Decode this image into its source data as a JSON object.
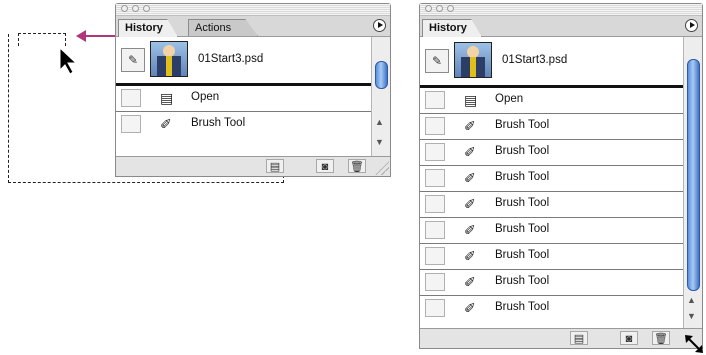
{
  "small_panel": {
    "tabs": [
      {
        "label": "History"
      },
      {
        "label": "Actions"
      }
    ],
    "snapshot": {
      "label": "01Start3.psd"
    },
    "rows": [
      {
        "label": "Open",
        "icon": "open-document-icon"
      },
      {
        "label": "Brush Tool",
        "icon": "brush-icon"
      }
    ]
  },
  "large_panel": {
    "tabs": [
      {
        "label": "History"
      }
    ],
    "snapshot": {
      "label": "01Start3.psd"
    },
    "rows": [
      {
        "label": "Open",
        "icon": "open-document-icon"
      },
      {
        "label": "Brush Tool",
        "icon": "brush-icon"
      },
      {
        "label": "Brush Tool",
        "icon": "brush-icon"
      },
      {
        "label": "Brush Tool",
        "icon": "brush-icon"
      },
      {
        "label": "Brush Tool",
        "icon": "brush-icon"
      },
      {
        "label": "Brush Tool",
        "icon": "brush-icon"
      },
      {
        "label": "Brush Tool",
        "icon": "brush-icon"
      },
      {
        "label": "Brush Tool",
        "icon": "brush-icon"
      },
      {
        "label": "Brush Tool",
        "icon": "brush-icon"
      }
    ]
  },
  "colors": {
    "drag_arrow": "#b0357a",
    "scroll_thumb": "#5a8ddc"
  }
}
